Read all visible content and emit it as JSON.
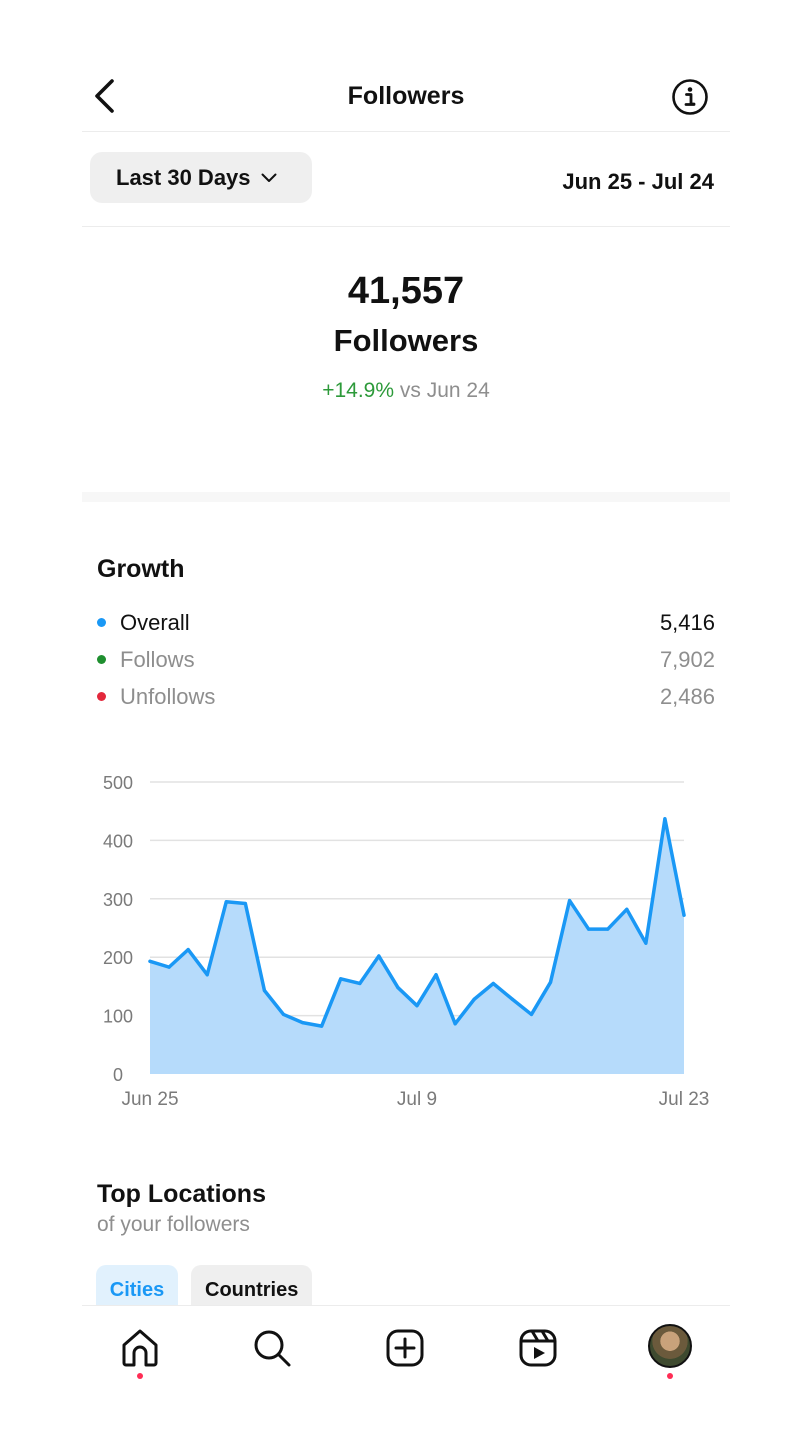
{
  "header": {
    "title": "Followers"
  },
  "range": {
    "label": "Last 30 Days",
    "dates": "Jun 25 - Jul 24"
  },
  "summary": {
    "count": "41,557",
    "label": "Followers",
    "delta_pct": "+14.9%",
    "delta_text": "vs Jun 24"
  },
  "growth": {
    "title": "Growth",
    "legend": [
      {
        "label": "Overall",
        "value": "5,416",
        "color": "#1a98f5"
      },
      {
        "label": "Follows",
        "value": "7,902",
        "color": "#1f8f2f"
      },
      {
        "label": "Unfollows",
        "value": "2,486",
        "color": "#e3283c"
      }
    ]
  },
  "chart_data": {
    "type": "area",
    "x": [
      "Jun 25",
      "Jun 26",
      "Jun 27",
      "Jun 28",
      "Jun 29",
      "Jun 30",
      "Jul 1",
      "Jul 2",
      "Jul 3",
      "Jul 4",
      "Jul 5",
      "Jul 6",
      "Jul 7",
      "Jul 8",
      "Jul 9",
      "Jul 10",
      "Jul 11",
      "Jul 12",
      "Jul 13",
      "Jul 14",
      "Jul 15",
      "Jul 16",
      "Jul 17",
      "Jul 18",
      "Jul 19",
      "Jul 20",
      "Jul 21",
      "Jul 22",
      "Jul 23"
    ],
    "series": [
      {
        "values": [
          193,
          183,
          213,
          170,
          295,
          292,
          143,
          102,
          88,
          82,
          163,
          155,
          202,
          148,
          117,
          170,
          86,
          128,
          155,
          128,
          102,
          157,
          297,
          248,
          248,
          282,
          224,
          437,
          272
        ]
      }
    ],
    "ylim": [
      0,
      500
    ],
    "yticks": [
      "0",
      "100",
      "200",
      "300",
      "400",
      "500"
    ],
    "xticks": [
      "Jun 25",
      "Jul 9",
      "Jul 23"
    ],
    "xlabel": "",
    "ylabel": "",
    "grid": true,
    "line_color": "#1a98f5",
    "fill_color": "#b6dbfb"
  },
  "locations": {
    "title": "Top Locations",
    "subtitle": "of your followers",
    "tabs": [
      "Cities",
      "Countries"
    ]
  },
  "nav": {
    "items": [
      "home-icon",
      "search-icon",
      "create-icon",
      "reels-icon",
      "profile-avatar"
    ],
    "accent": "#ff2d55"
  }
}
